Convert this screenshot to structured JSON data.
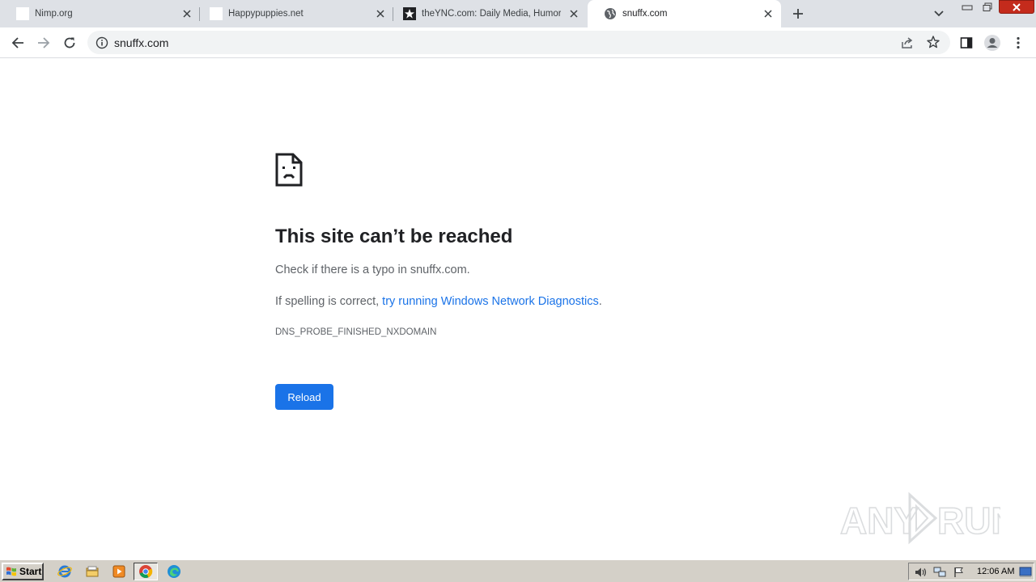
{
  "browser": {
    "tabs": [
      {
        "title": "Nimp.org",
        "active": false,
        "favicon": "blank-page-icon"
      },
      {
        "title": "Happypuppies.net",
        "active": false,
        "favicon": "blank-page-icon"
      },
      {
        "title": "theYNC.com: Daily Media, Humor, Sh",
        "active": false,
        "favicon": "star-icon"
      },
      {
        "title": "snuffx.com",
        "active": true,
        "favicon": "globe-icon"
      }
    ],
    "address_bar": {
      "url": "snuffx.com"
    }
  },
  "error_page": {
    "heading": "This site can’t be reached",
    "line1": "Check if there is a typo in snuffx.com.",
    "line2_prefix": "If spelling is correct, ",
    "line2_link": "try running Windows Network Diagnostics",
    "line2_suffix": ".",
    "error_code": "DNS_PROBE_FINISHED_NXDOMAIN",
    "reload_label": "Reload"
  },
  "watermark": {
    "text": "ANY RUN"
  },
  "taskbar": {
    "start_label": "Start",
    "clock": "12:06 AM"
  },
  "colors": {
    "accent": "#1a73e8",
    "tabstrip": "#dee1e6",
    "taskbar": "#d4d0c8",
    "close_red": "#c42b1c"
  }
}
